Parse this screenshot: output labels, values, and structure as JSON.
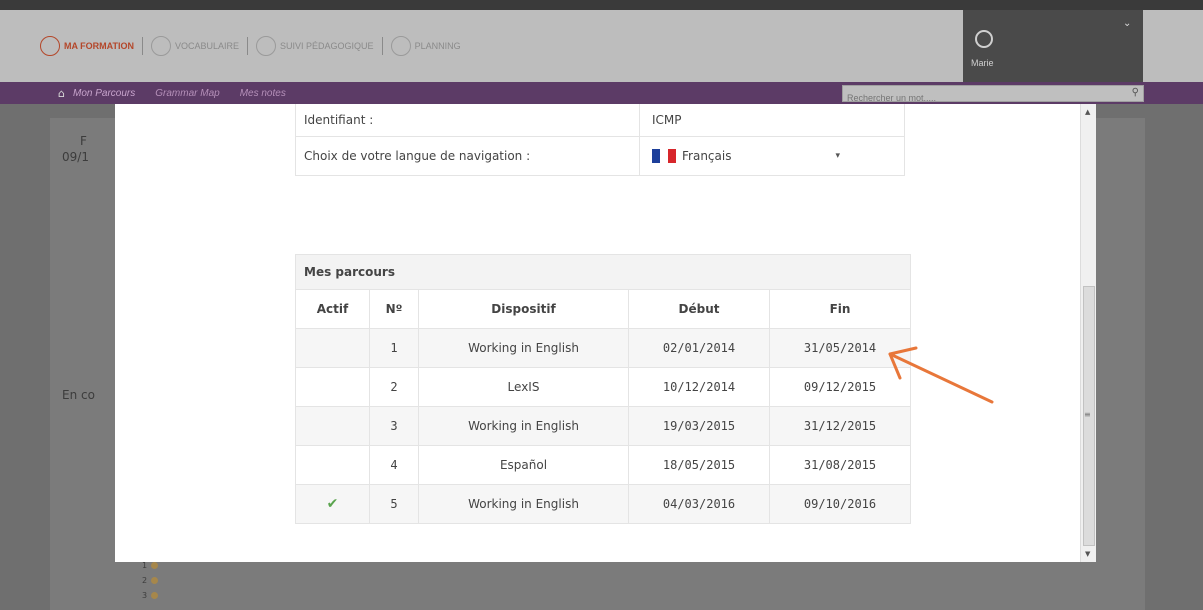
{
  "header": {
    "nav": [
      {
        "label": "MA FORMATION",
        "active": true
      },
      {
        "label": "VOCABULAIRE",
        "active": false
      },
      {
        "label": "SUIVI PÉDAGOGIQUE",
        "active": false
      },
      {
        "label": "PLANNING",
        "active": false
      }
    ],
    "user_name": "Marie"
  },
  "subnav": {
    "items": [
      "Mon Parcours",
      "Grammar Map",
      "Mes notes"
    ],
    "search_placeholder": "Rechercher un mot....."
  },
  "background": {
    "text1": "F",
    "text2": "09/1",
    "text3": "En co",
    "dots": [
      "1",
      "2",
      "3"
    ]
  },
  "profile": {
    "id_label": "Identifiant :",
    "id_value": "ICMP",
    "lang_label": "Choix de votre langue de navigation :",
    "lang_value": "Français"
  },
  "parcours": {
    "caption": "Mes parcours",
    "headers": [
      "Actif",
      "Nº",
      "Dispositif",
      "Début",
      "Fin"
    ],
    "rows": [
      {
        "actif": "",
        "no": "1",
        "dispositif": "Working in English",
        "debut": "02/01/2014",
        "fin": "31/05/2014"
      },
      {
        "actif": "",
        "no": "2",
        "dispositif": "LexIS",
        "debut": "10/12/2014",
        "fin": "09/12/2015"
      },
      {
        "actif": "",
        "no": "3",
        "dispositif": "Working in English",
        "debut": "19/03/2015",
        "fin": "31/12/2015"
      },
      {
        "actif": "",
        "no": "4",
        "dispositif": "Español",
        "debut": "18/05/2015",
        "fin": "31/08/2015"
      },
      {
        "actif": "✔",
        "no": "5",
        "dispositif": "Working in English",
        "debut": "04/03/2016",
        "fin": "09/10/2016"
      }
    ]
  },
  "colors": {
    "subnav_bg": "#5c3b66",
    "accent": "#b4472a",
    "arrow": "#e8773a",
    "check": "#5aa44e"
  }
}
